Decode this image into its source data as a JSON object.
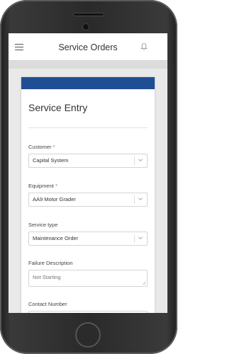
{
  "app": {
    "title": "Service Orders"
  },
  "form": {
    "heading": "Service Entry",
    "customer_label": "Customer",
    "customer_value": "Capital System",
    "equipment_label": "Equipment",
    "equipment_value": "AA9 Motor Grader",
    "service_type_label": "Service type",
    "service_type_value": "Maintenance Order",
    "failure_label": "Failure Description",
    "failure_placeholder": "Not Starting",
    "contact_label": "Contact Number",
    "required_mark": "*"
  },
  "colors": {
    "card_header": "#1f4e93",
    "required": "#d9534f"
  },
  "icons": [
    "menu-icon",
    "bell-icon",
    "chevron-down-icon"
  ]
}
